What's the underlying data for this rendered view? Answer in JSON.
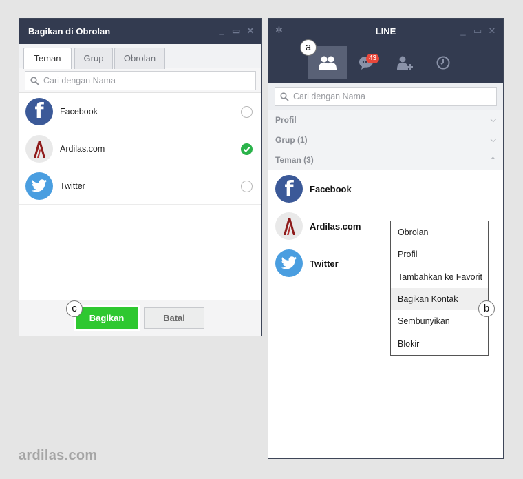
{
  "share_window": {
    "title": "Bagikan di Obrolan",
    "tabs": [
      {
        "label": "Teman",
        "active": true
      },
      {
        "label": "Grup",
        "active": false
      },
      {
        "label": "Obrolan",
        "active": false
      }
    ],
    "search_placeholder": "Cari dengan Nama",
    "contacts": [
      {
        "name": "Facebook",
        "selected": false
      },
      {
        "name": "Ardilas.com",
        "selected": true
      },
      {
        "name": "Twitter",
        "selected": false
      }
    ],
    "share_button": "Bagikan",
    "cancel_button": "Batal"
  },
  "line_window": {
    "title": "LINE",
    "nav_badge": "43",
    "search_placeholder": "Cari dengan Nama",
    "sections": [
      "Profil",
      "Grup (1)",
      "Teman (3)"
    ],
    "friends": [
      "Facebook",
      "Ardilas.com",
      "Twitter"
    ]
  },
  "context_menu": {
    "items": [
      "Obrolan",
      "Profil",
      "Tambahkan ke Favorit",
      "Bagikan Kontak",
      "Sembunyikan",
      "Blokir"
    ],
    "highlighted": "Bagikan Kontak"
  },
  "markers": {
    "a": "a",
    "b": "b",
    "c": "c"
  },
  "watermark": "ardilas.com",
  "colors": {
    "titlebar": "#333b50",
    "share_green": "#2ec830",
    "check_green": "#2ab34a",
    "badge_red": "#e8473a"
  }
}
